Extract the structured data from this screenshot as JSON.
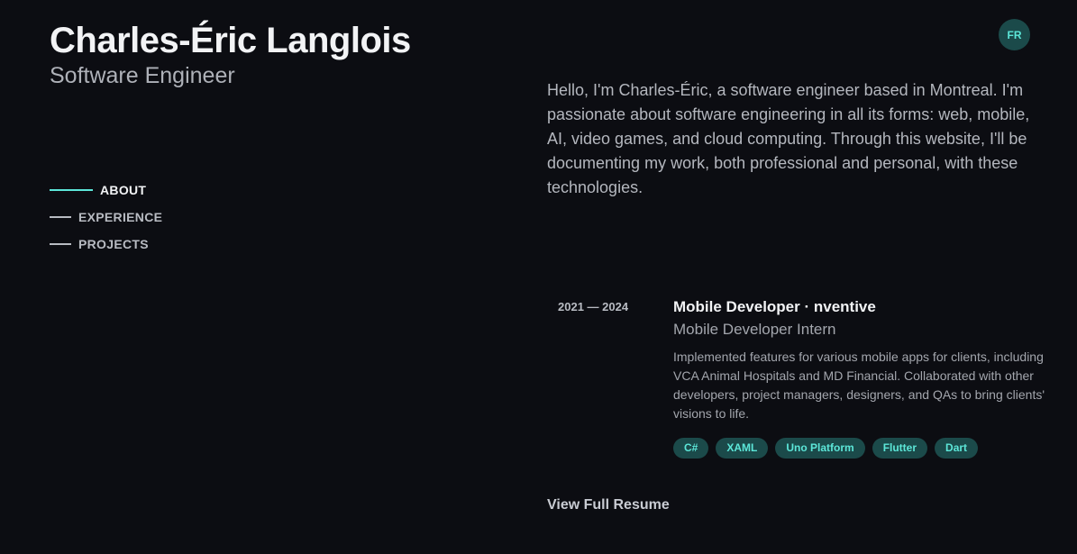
{
  "header": {
    "name": "Charles-Éric Langlois",
    "role": "Software Engineer",
    "lang_toggle": "FR"
  },
  "nav": {
    "items": [
      {
        "label": "ABOUT",
        "active": true
      },
      {
        "label": "EXPERIENCE",
        "active": false
      },
      {
        "label": "PROJECTS",
        "active": false
      }
    ]
  },
  "about": {
    "text": "Hello, I'm Charles-Éric, a software engineer based in Montreal. I'm passionate about software engineering in all its forms: web, mobile, AI, video games, and cloud computing. Through this website, I'll be documenting my work, both professional and personal, with these technologies."
  },
  "experience": {
    "date": "2021 — 2024",
    "title": "Mobile Developer · nventive",
    "subtitle": "Mobile Developer Intern",
    "description": "Implemented features for various mobile apps for clients, including VCA Animal Hospitals and MD Financial. Collaborated with other developers, project managers, designers, and QAs to bring clients' visions to life.",
    "tags": [
      "C#",
      "XAML",
      "Uno Platform",
      "Flutter",
      "Dart"
    ]
  },
  "resume_link": "View Full Resume",
  "colors": {
    "background": "#0c0d12",
    "accent": "#5ce6d8",
    "tag_background": "#1b4a4a"
  }
}
